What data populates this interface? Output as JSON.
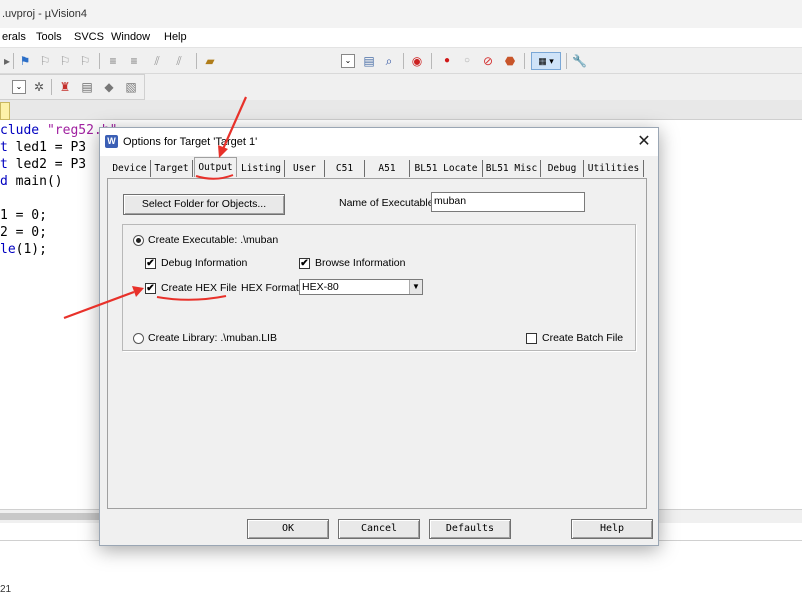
{
  "window": {
    "title": ".uvproj - µVision4"
  },
  "menu": [
    "erals",
    "Tools",
    "SVCS",
    "Window",
    "Help"
  ],
  "editor": {
    "lines": [
      {
        "kw": "clude",
        "rest": " ",
        "str": "\"reg52.h\""
      },
      {
        "kw": "t",
        "rest": " led1 = P3"
      },
      {
        "kw": "t",
        "rest": " led2 = P3"
      },
      {
        "kw": "d",
        "rest": " main()"
      },
      {
        "kw": "",
        "rest": ""
      },
      {
        "kw": "",
        "rest": "1 = 0;"
      },
      {
        "kw": "",
        "rest": "2 = 0;"
      },
      {
        "kw": "le",
        "rest": "(1);"
      }
    ],
    "bottom_text": "21"
  },
  "dialog": {
    "title": "Options for Target 'Target 1'",
    "close_glyph": "✕",
    "icon_text": "W",
    "tabs": [
      "Device",
      "Target",
      "Output",
      "Listing",
      "User",
      "C51",
      "A51",
      "BL51 Locate",
      "BL51 Misc",
      "Debug",
      "Utilities"
    ],
    "active_tab": "Output",
    "select_folder_label": "Select Folder for Objects...",
    "name_of_executable_label": "Name of Executable:",
    "name_of_executable_value": "muban",
    "create_executable_label": "Create Executable:  .\\muban",
    "debug_info_label": "Debug Information",
    "browse_info_label": "Browse Information",
    "create_hex_label": "Create HEX File",
    "hex_format_label": "HEX Format:",
    "hex_format_value": "HEX-80",
    "create_library_label": "Create Library:  .\\muban.LIB",
    "create_batch_label": "Create Batch File",
    "checked_glyph": "✔",
    "checkboxes": {
      "debug_info": true,
      "browse_info": true,
      "create_hex": true,
      "create_batch": false
    },
    "radio_selected": "create_executable",
    "buttons": {
      "ok": "OK",
      "cancel": "Cancel",
      "defaults": "Defaults",
      "help": "Help"
    }
  },
  "colors": {
    "annotation": "#e8312a",
    "keyword": "#0000c0",
    "string": "#a020a0"
  }
}
